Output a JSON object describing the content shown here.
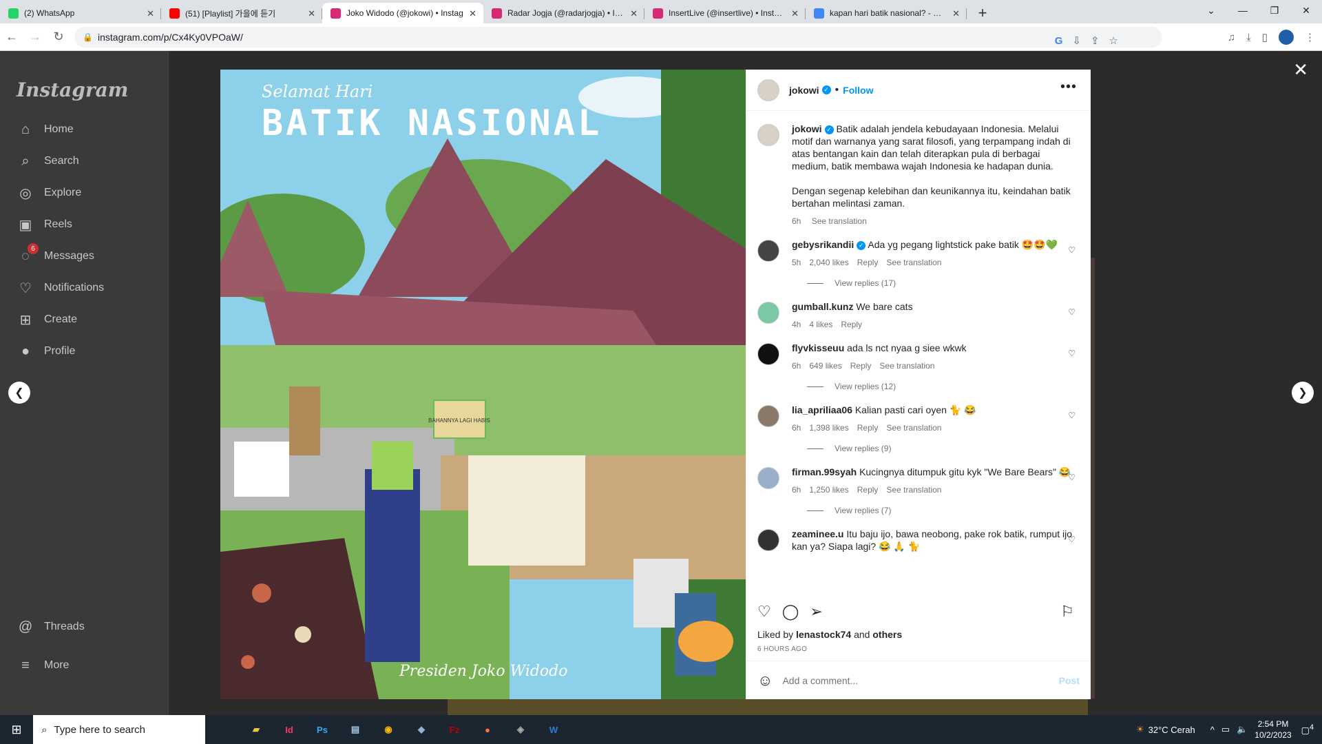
{
  "browser": {
    "tabs": [
      {
        "title": "(2) WhatsApp",
        "icon": "whatsapp-icon",
        "color": "#25d366",
        "active": false
      },
      {
        "title": "(51) [Playlist] 가을에 듣기",
        "icon": "youtube-icon",
        "color": "#ff0000",
        "active": false
      },
      {
        "title": "Joko Widodo (@jokowi) • Instag",
        "icon": "instagram-icon",
        "color": "#d62976",
        "active": true
      },
      {
        "title": "Radar Jogja (@radarjogja) • Insta",
        "icon": "instagram-icon",
        "color": "#d62976",
        "active": false
      },
      {
        "title": "InsertLive (@insertlive) • Instagra",
        "icon": "instagram-icon",
        "color": "#d62976",
        "active": false
      },
      {
        "title": "kapan hari batik nasional? - Goo",
        "icon": "google-icon",
        "color": "#4285f4",
        "active": false
      }
    ],
    "url": "instagram.com/p/Cx4Ky0VPOaW/"
  },
  "sidebar": {
    "logo": "Instagram",
    "items": [
      {
        "label": "Home",
        "icon": "home-icon",
        "glyph": "⌂"
      },
      {
        "label": "Search",
        "icon": "search-icon",
        "glyph": "⌕"
      },
      {
        "label": "Explore",
        "icon": "compass-icon",
        "glyph": "◎"
      },
      {
        "label": "Reels",
        "icon": "reels-icon",
        "glyph": "▣"
      },
      {
        "label": "Messages",
        "icon": "messenger-icon",
        "glyph": "◌",
        "badge": "6"
      },
      {
        "label": "Notifications",
        "icon": "heart-icon",
        "glyph": "♡"
      },
      {
        "label": "Create",
        "icon": "plus-square-icon",
        "glyph": "⊞"
      },
      {
        "label": "Profile",
        "icon": "avatar",
        "glyph": "●"
      }
    ],
    "bottom": [
      {
        "label": "Threads",
        "icon": "threads-icon",
        "glyph": "@"
      },
      {
        "label": "More",
        "icon": "menu-icon",
        "glyph": "≡"
      }
    ]
  },
  "post": {
    "image": {
      "title_script": "Selamat Hari",
      "title": "BATIK NASIONAL",
      "signature": "Presiden Joko Widodo",
      "sign_text": "BAHANNYA LAGI HABIS"
    },
    "author": "jokowi",
    "follow": "Follow",
    "caption": "Batik adalah jendela kebudayaan Indonesia. Melalui motif dan warnanya yang sarat filosofi, yang terpampang indah di atas bentangan kain dan telah diterapkan pula di berbagai medium, batik membawa wajah Indonesia ke hadapan dunia.",
    "caption2": "Dengan segenap kelebihan dan keunikannya itu, keindahan batik bertahan melintasi zaman.",
    "caption_time": "6h",
    "see_translation": "See translation",
    "comments": [
      {
        "user": "gebysrikandii",
        "verified": true,
        "text": "Ada yg pegang lightstick pake batik 🤩🤩💚",
        "time": "5h",
        "likes": "2,040 likes",
        "translate": true,
        "replies": "View replies (17)"
      },
      {
        "user": "gumball.kunz",
        "verified": false,
        "text": "We bare cats",
        "time": "4h",
        "likes": "4 likes",
        "translate": false,
        "replies": ""
      },
      {
        "user": "flyvkisseuu",
        "verified": false,
        "text": "ada ls nct nyaa g siee wkwk",
        "time": "6h",
        "likes": "649 likes",
        "translate": true,
        "replies": "View replies (12)"
      },
      {
        "user": "lia_apriliaa06",
        "verified": false,
        "text": "Kalian pasti cari oyen 🐈 😂",
        "time": "6h",
        "likes": "1,398 likes",
        "translate": true,
        "replies": "View replies (9)"
      },
      {
        "user": "firman.99syah",
        "verified": false,
        "text": "Kucingnya ditumpuk gitu kyk \"We Bare Bears\" 😂",
        "time": "6h",
        "likes": "1,250 likes",
        "translate": true,
        "replies": "View replies (7)"
      },
      {
        "user": "zeaminee.u",
        "verified": false,
        "text": "Itu baju ijo, bawa neobong, pake rok batik, rumput ijo kan ya? Siapa lagi? 😂 🙏 🐈",
        "time": "",
        "likes": "",
        "translate": false,
        "replies": ""
      }
    ],
    "reply_label": "Reply",
    "liked_by_user": "lenastock74",
    "liked_by_others": "others",
    "time_ago": "6 HOURS AGO",
    "add_comment_placeholder": "Add a comment...",
    "post_button": "Post"
  },
  "taskbar": {
    "search_placeholder": "Type here to search",
    "weather": "32°C  Cerah",
    "time": "2:54 PM",
    "date": "10/2/2023",
    "notifications": "4"
  }
}
